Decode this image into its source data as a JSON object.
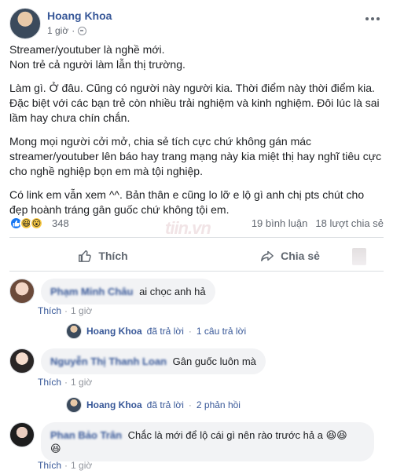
{
  "post": {
    "author": "Hoang Khoa",
    "time": "1 giờ",
    "paragraphs": [
      "Streamer/youtuber là nghề mới.\nNon trẻ cả người làm lẫn thị trường.",
      "Làm gì. Ở đâu. Cũng có người này người kia. Thời điểm này thời điểm kia. Đặc biệt với các bạn trẻ còn nhiều trải nghiệm và kinh nghiệm. Đôi lúc là sai lầm hay chưa chín chắn.",
      "Mong mọi người cởi mở, chia sẻ tích cực chứ không gán mác streamer/youtuber lên báo hay trang mạng này kia miệt thị hay nghĩ tiêu cực cho nghề nghiệp bọn em mà tội nghiệp.",
      "Có link em vẫn xem ^^. Bản thân e cũng lo lỡ e lộ gì anh chị pts chút cho đẹp hoành tráng gân guốc chứ không tội em."
    ],
    "reaction_count": "348",
    "comment_count": "19 bình luận",
    "share_count": "18 lượt chia sẻ",
    "reaction_icons": [
      "like-icon",
      "haha-icon",
      "wow-icon"
    ]
  },
  "actions": {
    "like_label": "Thích",
    "share_label": "Chia sẻ"
  },
  "comments": [
    {
      "name": "Phạm Minh Châu",
      "text": "ai chọc anh hả",
      "like_label": "Thích",
      "time": "1 giờ",
      "reply_author": "Hoang Khoa",
      "reply_action": "đã trả lời",
      "reply_count": "1 câu trả lời"
    },
    {
      "name": "Nguyễn Thị Thanh Loan",
      "text": "Gân guốc luôn mà",
      "like_label": "Thích",
      "time": "1 giờ",
      "reply_author": "Hoang Khoa",
      "reply_action": "đã trả lời",
      "reply_count": "2 phản hồi"
    },
    {
      "name": "Phan Bảo Trân",
      "text": "Chắc là mới để lộ cái gì nên rào trước hả a",
      "like_label": "Thích",
      "time": "1 giờ"
    }
  ],
  "colors": {
    "link": "#385898",
    "muted": "#616770",
    "like_blue": "#1877f2",
    "bubble": "#f2f3f5"
  }
}
